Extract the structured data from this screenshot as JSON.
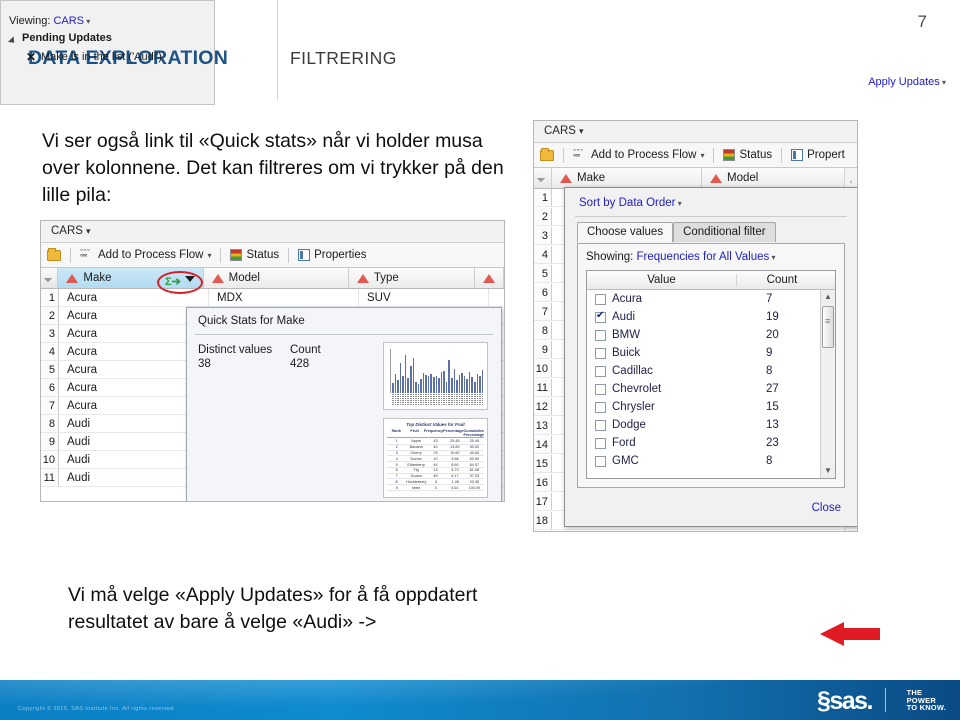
{
  "slide": {
    "page_number": "7",
    "title_main": "DATA EXPLORATION",
    "title_sub": "FILTRERING",
    "intro_text": "Vi ser også link til «Quick stats» når vi holder musa over kolonnene. Det kan filtreres om vi trykker på den lille pila:",
    "outro_text": "Vi må velge «Apply Updates» for å få oppdatert resultatet av bare å velge «Audi» ->"
  },
  "left_screenshot": {
    "tab_label": "CARS",
    "toolbar": {
      "open_icon": "folder-icon",
      "add_to_process_flow": "Add to Process Flow",
      "status": "Status",
      "properties": "Properties"
    },
    "grid_headers": [
      "Make",
      "Model",
      "Type"
    ],
    "selected_header": "Make",
    "rows": [
      {
        "num": "1",
        "make": "Acura",
        "model": "MDX",
        "type": "SUV"
      },
      {
        "num": "2",
        "make": "Acura",
        "model": "",
        "type": ""
      },
      {
        "num": "3",
        "make": "Acura",
        "model": "",
        "type": ""
      },
      {
        "num": "4",
        "make": "Acura",
        "model": "",
        "type": ""
      },
      {
        "num": "5",
        "make": "Acura",
        "model": "",
        "type": ""
      },
      {
        "num": "6",
        "make": "Acura",
        "model": "",
        "type": ""
      },
      {
        "num": "7",
        "make": "Acura",
        "model": "",
        "type": ""
      },
      {
        "num": "8",
        "make": "Audi",
        "model": "",
        "type": ""
      },
      {
        "num": "9",
        "make": "Audi",
        "model": "",
        "type": ""
      },
      {
        "num": "10",
        "make": "Audi",
        "model": "",
        "type": ""
      },
      {
        "num": "11",
        "make": "Audi",
        "model": "",
        "type": ""
      }
    ],
    "quick_stats": {
      "title": "Quick Stats for Make",
      "distinct_values_label": "Distinct values",
      "distinct_values": "38",
      "count_label": "Count",
      "count": "428",
      "mini_table_title": "Top Distinct Values for Fruit",
      "mini_table_headers": [
        "Rank",
        "Fruit",
        "Frequency",
        "Percentage",
        "Cumulative Percentage"
      ],
      "mini_table_rows": [
        [
          "1",
          "Apple",
          "43",
          "25.45",
          "25.45"
        ],
        [
          "2",
          "Banana",
          "40",
          "13.60",
          "39.02"
        ],
        [
          "3",
          "Cherry",
          "29",
          "10.60",
          "49.60"
        ],
        [
          "4",
          "Durian",
          "10",
          "3.88",
          "53.50"
        ],
        [
          "5",
          "Elderberry",
          "44",
          "8.60",
          "64.57"
        ],
        [
          "6",
          "Fig",
          "13",
          "4.79",
          "81.08"
        ],
        [
          "7",
          "Guava",
          "45",
          "6.17",
          "97.03"
        ],
        [
          "8",
          "Huckleberry",
          "3",
          "1.26",
          "93.38"
        ],
        [
          "9",
          "Imbe",
          "3",
          "4.61",
          "100.00"
        ]
      ]
    }
  },
  "right_screenshot": {
    "tab_label": "CARS",
    "toolbar": {
      "add_to_process_flow": "Add to Process Flow",
      "status": "Status",
      "properties": "Propert"
    },
    "grid_headers": [
      "Make",
      "Model"
    ],
    "row_numbers": [
      "1",
      "2",
      "3",
      "4",
      "5",
      "6",
      "7",
      "8",
      "9",
      "10",
      "11",
      "12",
      "13",
      "14",
      "15",
      "16",
      "17",
      "18"
    ],
    "filter_popup": {
      "sort_link": "Sort by Data Order",
      "tabs": [
        {
          "label": "Choose values",
          "active": true
        },
        {
          "label": "Conditional filter",
          "active": false
        }
      ],
      "showing_label": "Showing:",
      "showing_value": "Frequencies for All Values",
      "columns": [
        "Value",
        "Count"
      ],
      "values": [
        {
          "value": "Acura",
          "count": "7",
          "checked": false
        },
        {
          "value": "Audi",
          "count": "19",
          "checked": true
        },
        {
          "value": "BMW",
          "count": "20",
          "checked": false
        },
        {
          "value": "Buick",
          "count": "9",
          "checked": false
        },
        {
          "value": "Cadillac",
          "count": "8",
          "checked": false
        },
        {
          "value": "Chevrolet",
          "count": "27",
          "checked": false
        },
        {
          "value": "Chrysler",
          "count": "15",
          "checked": false
        },
        {
          "value": "Dodge",
          "count": "13",
          "checked": false
        },
        {
          "value": "Ford",
          "count": "23",
          "checked": false
        },
        {
          "value": "GMC",
          "count": "8",
          "checked": false
        }
      ],
      "close_label": "Close"
    }
  },
  "pending_panel": {
    "viewing_label": "Viewing:",
    "viewing_value": "CARS",
    "section_title": "Pending Updates",
    "item_text": "Make is in the list ('Audi')",
    "apply_label": "Apply Updates"
  },
  "footer": {
    "copyright": "Copyright © 2015, SAS Institute Inc. All rights reserved.",
    "logo_text": "§sas.",
    "tagline_line1": "THE",
    "tagline_line2": "POWER",
    "tagline_line3": "TO KNOW."
  },
  "colors": {
    "brand_blue": "#1b5288",
    "link_blue": "#2020c8",
    "accent_red": "#e01b24",
    "footer_blue": "#0b7fc4"
  }
}
